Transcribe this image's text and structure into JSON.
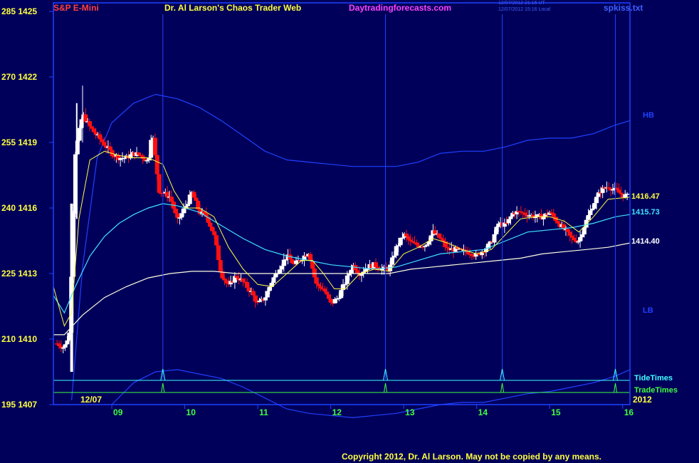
{
  "header": {
    "symbol": "S&P E-Mini",
    "title": "Dr. Al Larson's Chaos Trader Web",
    "website": "Daytradingforecasts.com",
    "time_ut": "12/07/2012 21:16 UT",
    "time_local": "12/07/2012 15:16 Local",
    "filename": "spkiss.txt"
  },
  "footer": {
    "copyright": "Copyright 2012, Dr. Al Larson. May not be copied by any means."
  },
  "colors": {
    "background": "#00005a",
    "frame": "#2040ff",
    "up_bar": "#ffffff",
    "down_bar": "#ff1010",
    "ma_fast": "#ffff40",
    "ma_mid": "#40e0ff",
    "ma_slow": "#ffffe0",
    "tide": "#40ffff",
    "trade": "#40ff40"
  },
  "chart_data": {
    "type": "candlestick",
    "title": "S&P E-Mini",
    "y_axis_labels": [
      {
        "osc": "285",
        "price": "1425",
        "value": 1425
      },
      {
        "osc": "270",
        "price": "1422",
        "value": 1422
      },
      {
        "osc": "255",
        "price": "1419",
        "value": 1419
      },
      {
        "osc": "240",
        "price": "1416",
        "value": 1416
      },
      {
        "osc": "225",
        "price": "1413",
        "value": 1413
      },
      {
        "osc": "210",
        "price": "1410",
        "value": 1410
      },
      {
        "osc": "195",
        "price": "1407",
        "value": 1407
      }
    ],
    "ylim": [
      1407,
      1425
    ],
    "x_axis": {
      "start_date": "12/07",
      "year": "2012",
      "hour_labels": [
        "09",
        "10",
        "11",
        "12",
        "13",
        "14",
        "15",
        "16"
      ],
      "xlim_hours": [
        8.2,
        16.1
      ]
    },
    "band_labels": {
      "upper": "HB",
      "lower": "LB"
    },
    "last_values": {
      "ma_fast": "1416.47",
      "ma_mid": "1415.73",
      "ma_slow": "1414.40"
    },
    "timing_lines": {
      "tide_label": "TideTimes",
      "trade_label": "TradeTimes",
      "tide_hours": [
        9.7,
        12.75,
        14.35,
        15.9
      ],
      "trade_hours": [
        9.7,
        12.75,
        14.35,
        15.9
      ]
    },
    "price_anchors": [
      [
        8.25,
        1409.8
      ],
      [
        8.35,
        1409.6
      ],
      [
        8.42,
        1410.3
      ],
      [
        8.5,
        1418.5
      ],
      [
        8.6,
        1420.3
      ],
      [
        8.7,
        1419.7
      ],
      [
        8.8,
        1419.3
      ],
      [
        8.9,
        1418.9
      ],
      [
        9.0,
        1418.5
      ],
      [
        9.1,
        1418.3
      ],
      [
        9.2,
        1418.3
      ],
      [
        9.3,
        1418.5
      ],
      [
        9.4,
        1418.4
      ],
      [
        9.5,
        1418.1
      ],
      [
        9.55,
        1419.6
      ],
      [
        9.65,
        1416.8
      ],
      [
        9.8,
        1416.5
      ],
      [
        9.9,
        1415.4
      ],
      [
        10.0,
        1416.0
      ],
      [
        10.1,
        1416.7
      ],
      [
        10.2,
        1415.8
      ],
      [
        10.3,
        1415.6
      ],
      [
        10.4,
        1414.8
      ],
      [
        10.5,
        1413.0
      ],
      [
        10.6,
        1412.4
      ],
      [
        10.7,
        1412.9
      ],
      [
        10.8,
        1412.6
      ],
      [
        10.9,
        1412.2
      ],
      [
        11.0,
        1411.6
      ],
      [
        11.1,
        1411.9
      ],
      [
        11.2,
        1412.7
      ],
      [
        11.3,
        1413.3
      ],
      [
        11.4,
        1413.8
      ],
      [
        11.5,
        1413.4
      ],
      [
        11.6,
        1413.7
      ],
      [
        11.7,
        1414.0
      ],
      [
        11.8,
        1412.5
      ],
      [
        11.9,
        1412.3
      ],
      [
        12.0,
        1411.6
      ],
      [
        12.1,
        1411.9
      ],
      [
        12.2,
        1412.6
      ],
      [
        12.3,
        1413.4
      ],
      [
        12.4,
        1413.0
      ],
      [
        12.5,
        1413.3
      ],
      [
        12.6,
        1413.4
      ],
      [
        12.7,
        1413.2
      ],
      [
        12.8,
        1413.2
      ],
      [
        12.9,
        1414.2
      ],
      [
        13.0,
        1414.8
      ],
      [
        13.1,
        1414.4
      ],
      [
        13.2,
        1414.3
      ],
      [
        13.3,
        1414.3
      ],
      [
        13.4,
        1414.9
      ],
      [
        13.5,
        1414.6
      ],
      [
        13.6,
        1414.1
      ],
      [
        13.7,
        1414.1
      ],
      [
        13.8,
        1414.0
      ],
      [
        13.9,
        1414.0
      ],
      [
        14.0,
        1413.8
      ],
      [
        14.1,
        1414.1
      ],
      [
        14.2,
        1414.4
      ],
      [
        14.3,
        1415.3
      ],
      [
        14.4,
        1415.2
      ],
      [
        14.5,
        1415.8
      ],
      [
        14.6,
        1415.8
      ],
      [
        14.7,
        1415.7
      ],
      [
        14.8,
        1415.6
      ],
      [
        14.9,
        1415.6
      ],
      [
        15.0,
        1415.8
      ],
      [
        15.1,
        1415.4
      ],
      [
        15.2,
        1415.0
      ],
      [
        15.3,
        1414.6
      ],
      [
        15.4,
        1414.5
      ],
      [
        15.5,
        1415.4
      ],
      [
        15.6,
        1416.2
      ],
      [
        15.7,
        1416.8
      ],
      [
        15.8,
        1417.0
      ],
      [
        15.9,
        1416.8
      ],
      [
        16.0,
        1416.6
      ],
      [
        16.1,
        1416.5
      ]
    ],
    "ma_fast_anchors": [
      [
        8.2,
        1412.4
      ],
      [
        8.35,
        1410.6
      ],
      [
        8.45,
        1411.2
      ],
      [
        8.55,
        1415.5
      ],
      [
        8.7,
        1418.2
      ],
      [
        8.9,
        1418.6
      ],
      [
        9.1,
        1418.4
      ],
      [
        9.3,
        1418.3
      ],
      [
        9.5,
        1418.3
      ],
      [
        9.7,
        1418.0
      ],
      [
        9.85,
        1416.8
      ],
      [
        10.0,
        1416.0
      ],
      [
        10.2,
        1416.0
      ],
      [
        10.4,
        1415.6
      ],
      [
        10.6,
        1414.2
      ],
      [
        10.8,
        1413.2
      ],
      [
        11.0,
        1412.5
      ],
      [
        11.2,
        1412.4
      ],
      [
        11.4,
        1413.0
      ],
      [
        11.6,
        1413.6
      ],
      [
        11.75,
        1413.6
      ],
      [
        11.9,
        1413.0
      ],
      [
        12.05,
        1412.3
      ],
      [
        12.2,
        1412.3
      ],
      [
        12.4,
        1413.0
      ],
      [
        12.6,
        1413.2
      ],
      [
        12.8,
        1413.1
      ],
      [
        13.0,
        1413.9
      ],
      [
        13.2,
        1414.2
      ],
      [
        13.4,
        1414.6
      ],
      [
        13.6,
        1414.4
      ],
      [
        13.8,
        1414.1
      ],
      [
        14.0,
        1413.9
      ],
      [
        14.2,
        1414.1
      ],
      [
        14.4,
        1414.8
      ],
      [
        14.6,
        1415.5
      ],
      [
        14.8,
        1415.6
      ],
      [
        15.0,
        1415.6
      ],
      [
        15.2,
        1415.4
      ],
      [
        15.4,
        1414.9
      ],
      [
        15.6,
        1415.6
      ],
      [
        15.8,
        1416.4
      ],
      [
        16.1,
        1416.5
      ]
    ],
    "ma_mid_anchors": [
      [
        8.2,
        1412.0
      ],
      [
        8.35,
        1411.2
      ],
      [
        8.5,
        1412.4
      ],
      [
        8.7,
        1413.8
      ],
      [
        8.9,
        1414.7
      ],
      [
        9.1,
        1415.3
      ],
      [
        9.3,
        1415.7
      ],
      [
        9.5,
        1416.0
      ],
      [
        9.7,
        1416.2
      ],
      [
        9.9,
        1416.1
      ],
      [
        10.2,
        1415.8
      ],
      [
        10.5,
        1415.2
      ],
      [
        10.8,
        1414.6
      ],
      [
        11.1,
        1414.1
      ],
      [
        11.4,
        1413.8
      ],
      [
        11.7,
        1413.6
      ],
      [
        12.0,
        1413.4
      ],
      [
        12.3,
        1413.3
      ],
      [
        12.6,
        1413.2
      ],
      [
        12.9,
        1413.3
      ],
      [
        13.2,
        1413.6
      ],
      [
        13.5,
        1413.9
      ],
      [
        13.8,
        1414.0
      ],
      [
        14.1,
        1414.1
      ],
      [
        14.4,
        1414.5
      ],
      [
        14.7,
        1414.9
      ],
      [
        15.0,
        1415.0
      ],
      [
        15.3,
        1415.1
      ],
      [
        15.6,
        1415.3
      ],
      [
        15.9,
        1415.6
      ],
      [
        16.1,
        1415.7
      ]
    ],
    "ma_slow_anchors": [
      [
        8.2,
        1410.2
      ],
      [
        8.35,
        1410.2
      ],
      [
        8.6,
        1411.1
      ],
      [
        8.9,
        1411.9
      ],
      [
        9.2,
        1412.4
      ],
      [
        9.5,
        1412.8
      ],
      [
        9.8,
        1413.0
      ],
      [
        10.1,
        1413.1
      ],
      [
        10.4,
        1413.1
      ],
      [
        10.7,
        1413.0
      ],
      [
        11.0,
        1413.0
      ],
      [
        11.3,
        1413.0
      ],
      [
        11.6,
        1413.0
      ],
      [
        11.9,
        1413.0
      ],
      [
        12.2,
        1413.0
      ],
      [
        12.5,
        1413.0
      ],
      [
        12.8,
        1413.0
      ],
      [
        13.1,
        1413.2
      ],
      [
        13.4,
        1413.3
      ],
      [
        13.7,
        1413.4
      ],
      [
        14.0,
        1413.5
      ],
      [
        14.3,
        1413.6
      ],
      [
        14.6,
        1413.7
      ],
      [
        14.9,
        1413.9
      ],
      [
        15.2,
        1414.0
      ],
      [
        15.5,
        1414.1
      ],
      [
        15.8,
        1414.2
      ],
      [
        16.1,
        1414.4
      ]
    ],
    "band_upper_anchors": [
      [
        8.45,
        1407.2
      ],
      [
        8.6,
        1413.3
      ],
      [
        8.8,
        1418.3
      ],
      [
        9.0,
        1419.9
      ],
      [
        9.3,
        1420.8
      ],
      [
        9.6,
        1421.2
      ],
      [
        9.9,
        1421.0
      ],
      [
        10.2,
        1420.6
      ],
      [
        10.5,
        1420.0
      ],
      [
        10.8,
        1419.3
      ],
      [
        11.1,
        1418.6
      ],
      [
        11.4,
        1418.2
      ],
      [
        11.7,
        1418.1
      ],
      [
        12.0,
        1418.0
      ],
      [
        12.3,
        1417.9
      ],
      [
        12.6,
        1417.9
      ],
      [
        12.9,
        1417.9
      ],
      [
        13.2,
        1418.1
      ],
      [
        13.5,
        1418.5
      ],
      [
        13.8,
        1418.6
      ],
      [
        14.1,
        1418.6
      ],
      [
        14.4,
        1418.8
      ],
      [
        14.7,
        1419.1
      ],
      [
        15.0,
        1419.2
      ],
      [
        15.3,
        1419.2
      ],
      [
        15.6,
        1419.4
      ],
      [
        15.9,
        1419.8
      ],
      [
        16.1,
        1420.0
      ]
    ],
    "band_lower_anchors": [
      [
        9.0,
        1407.0
      ],
      [
        9.3,
        1408.0
      ],
      [
        9.6,
        1408.5
      ],
      [
        9.9,
        1408.6
      ],
      [
        10.2,
        1408.4
      ],
      [
        10.5,
        1408.2
      ],
      [
        10.8,
        1407.8
      ],
      [
        11.1,
        1407.3
      ],
      [
        11.4,
        1406.8
      ],
      [
        11.7,
        1406.6
      ],
      [
        12.0,
        1406.5
      ],
      [
        12.3,
        1406.4
      ],
      [
        12.6,
        1406.5
      ],
      [
        12.9,
        1406.6
      ],
      [
        13.2,
        1406.8
      ],
      [
        13.5,
        1407.0
      ],
      [
        13.8,
        1407.1
      ],
      [
        14.1,
        1407.1
      ],
      [
        14.4,
        1407.3
      ],
      [
        14.7,
        1407.5
      ],
      [
        15.0,
        1407.6
      ],
      [
        15.3,
        1407.8
      ],
      [
        15.6,
        1408.0
      ],
      [
        15.9,
        1408.3
      ],
      [
        16.1,
        1408.6
      ]
    ]
  }
}
